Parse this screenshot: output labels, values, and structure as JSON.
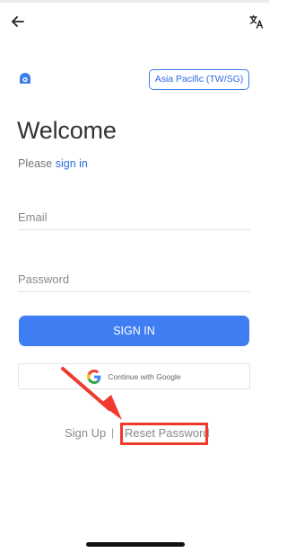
{
  "header": {
    "back_icon": "arrow-left-icon",
    "translate_icon": "translate-icon"
  },
  "logo_icon": "app-logo-icon",
  "region": {
    "label": "Asia Pacific (TW/SG)"
  },
  "welcome": {
    "title": "Welcome",
    "prompt_prefix": "Please",
    "prompt_link": "sign in"
  },
  "form": {
    "email_placeholder": "Email",
    "password_placeholder": "Password",
    "signin_label": "SIGN IN",
    "google_label": "Continue with Google"
  },
  "footer_links": {
    "signup": "Sign Up",
    "separator": "|",
    "reset": "Reset Password"
  },
  "colors": {
    "accent": "#3f7ef2",
    "link": "#2d6be4",
    "highlight": "#f03a2e"
  }
}
